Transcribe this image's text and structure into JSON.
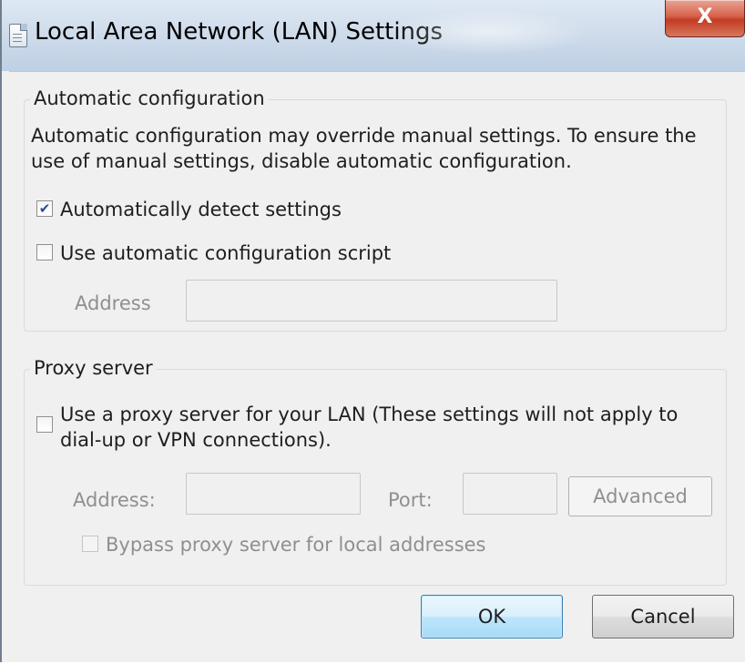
{
  "window": {
    "title": "Local Area Network (LAN) Settings",
    "close_label": "X"
  },
  "automatic_configuration": {
    "legend": "Automatic configuration",
    "description": "Automatic configuration may override manual settings.  To ensure the use of manual settings, disable automatic configuration.",
    "detect_settings": {
      "label": "Automatically detect settings",
      "checked": true
    },
    "use_script": {
      "label": "Use automatic configuration script",
      "checked": false
    },
    "address_label": "Address",
    "address_value": ""
  },
  "proxy_server": {
    "legend": "Proxy server",
    "use_proxy": {
      "label_line1": "Use a proxy server for your LAN (These settings will not apply to",
      "label_line2": "dial-up or VPN connections).",
      "checked": false
    },
    "address_label": "Address:",
    "address_value": "",
    "port_label": "Port:",
    "port_value": "",
    "advanced_label": "Advanced",
    "bypass": {
      "label": "Bypass proxy server for local addresses",
      "checked": false
    }
  },
  "footer": {
    "ok_label": "OK",
    "cancel_label": "Cancel"
  },
  "icons": {
    "title_icon": "document-icon",
    "checkmark": "checkmark-icon"
  },
  "colors": {
    "dialog_bg": "#f0f0f0",
    "close_button": "#c94630",
    "default_button_border": "#3c7fb1",
    "disabled_text": "#8f8f8f"
  }
}
